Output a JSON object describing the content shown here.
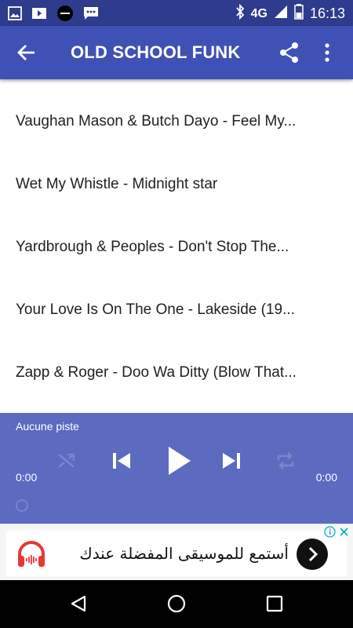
{
  "status_bar": {
    "left_icons": [
      "image-icon",
      "video-icon",
      "news-app-icon",
      "message-icon"
    ],
    "right_icons": [
      "bluetooth-icon",
      "signal-icon",
      "battery-icon"
    ],
    "network": "4G",
    "time": "16:13"
  },
  "app_bar": {
    "title": "OLD SCHOOL FUNK",
    "back_icon": "arrow-left-icon",
    "share_icon": "share-icon",
    "overflow_icon": "more-vert-icon"
  },
  "tracks": [
    "Vaughan Mason & Butch Dayo - Feel My...",
    "Wet My Whistle - Midnight star",
    "Yardbrough & Peoples - Don't Stop The...",
    "Your Love Is On The One - Lakeside (19...",
    "Zapp & Roger - Doo Wa Ditty (Blow That..."
  ],
  "player": {
    "track_label": "Aucune piste",
    "time_elapsed": "0:00",
    "time_total": "0:00",
    "controls": [
      "shuffle-icon",
      "previous-icon",
      "play-icon",
      "next-icon",
      "repeat-icon"
    ],
    "progress": 0
  },
  "ad": {
    "text": "أستمع للموسيقى المفضلة عندك",
    "icons": [
      "headphones-icon",
      "chevron-right-icon",
      "ad-info-icon",
      "ad-close-icon"
    ]
  },
  "nav_bar": [
    "back-triangle-icon",
    "home-circle-icon",
    "recents-square-icon"
  ],
  "colors": {
    "status_bar": "#2f3b8d",
    "app_bar": "#3f51b5",
    "player": "#5c6bc0",
    "disabled_icon": "#7986cb",
    "ad_accent": "#e53935",
    "nav_bar": "#000000"
  }
}
